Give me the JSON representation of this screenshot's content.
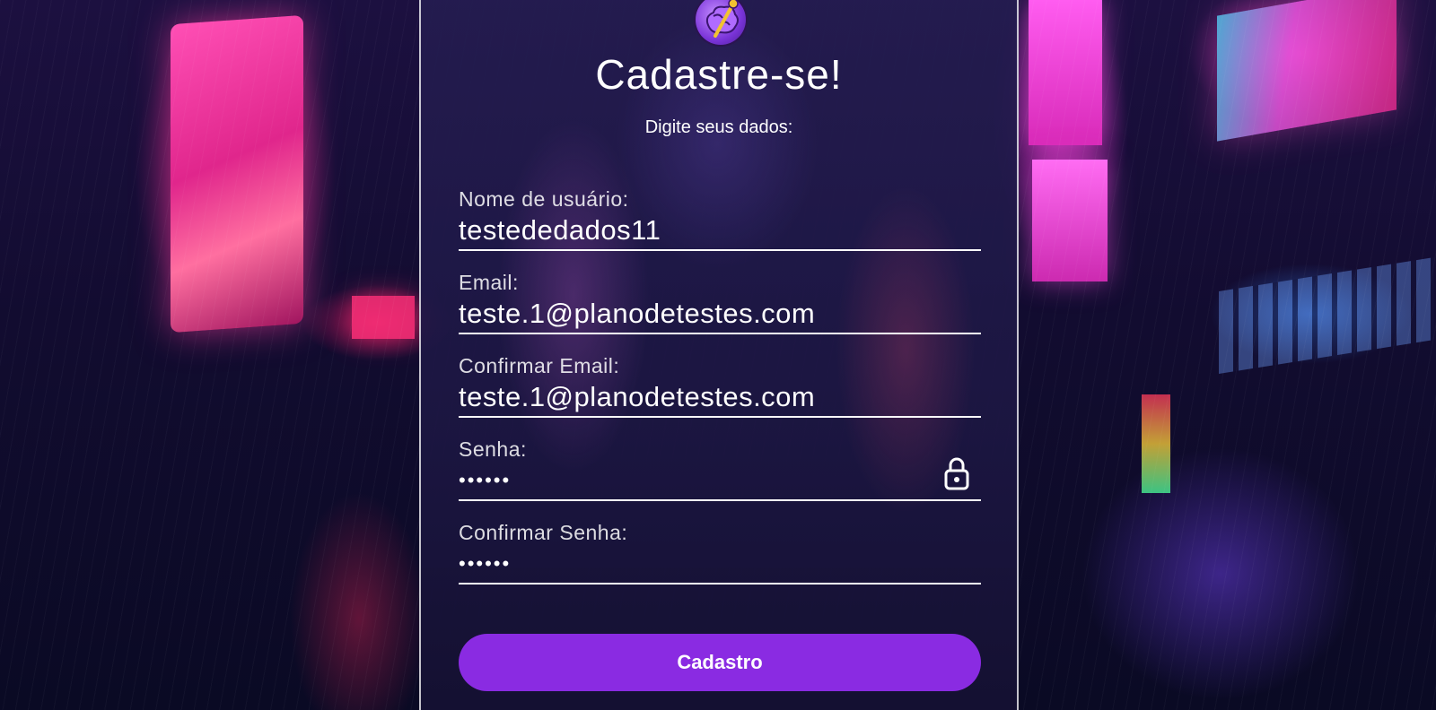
{
  "form": {
    "title": "Cadastre-se!",
    "subtitle": "Digite seus dados:",
    "fields": [
      {
        "label": "Nome de usuário:",
        "value": "testededados11"
      },
      {
        "label": "Email:",
        "value": "teste.1@planodetestes.com"
      },
      {
        "label": "Confirmar Email:",
        "value": "teste.1@planodetestes.com"
      },
      {
        "label": "Senha:",
        "value": "••••••"
      },
      {
        "label": "Confirmar Senha:",
        "value": "••••••"
      }
    ],
    "submit_label": "Cadastro"
  },
  "icons": {
    "logo": "brain-logo-icon",
    "password_toggle": "lock-icon"
  },
  "colors": {
    "accent": "#8a2be2",
    "text": "#ffffff",
    "panel": "#241c50"
  }
}
